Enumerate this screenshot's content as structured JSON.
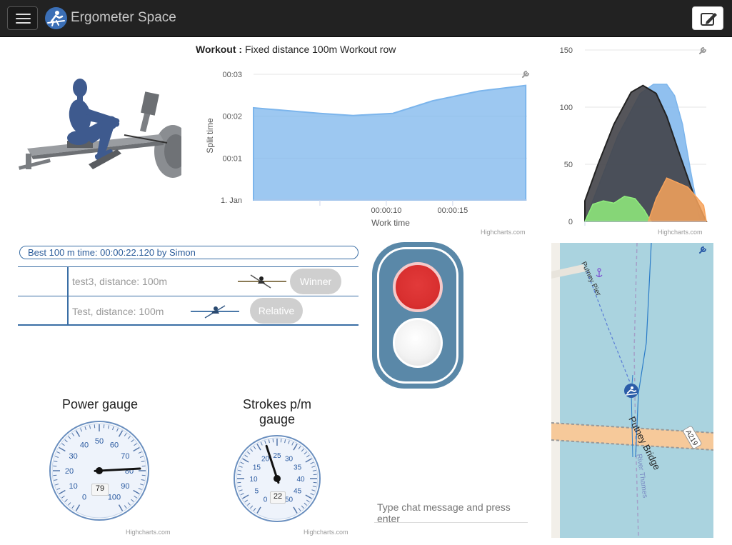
{
  "app": {
    "title": "Ergometer Space"
  },
  "navbar": {
    "menu_icon": "hamburger-icon",
    "logo_icon": "rower-logo-icon",
    "edit_icon": "edit-note-icon"
  },
  "workout": {
    "title_label": "Workout :",
    "title_text": "Fixed distance 100m Workout row"
  },
  "split_chart": {
    "chart_data": {
      "type": "area",
      "xlabel": "Work time",
      "ylabel": "Split time",
      "y_ticks": [
        "1. Jan",
        "00:01",
        "00:02",
        "00:03"
      ],
      "x_ticks": [
        "00:00:10",
        "00:00:15"
      ],
      "ylim_seconds": [
        0,
        180
      ],
      "xlim_seconds": [
        0,
        20.6
      ],
      "x": [
        0,
        5,
        7.5,
        10.5,
        13.5,
        17,
        20.5
      ],
      "y": [
        132,
        124,
        121,
        124,
        142,
        156,
        164
      ],
      "color": "#7cb5ec"
    },
    "credits": "Highcharts.com",
    "menu_icon": "wrench-icon"
  },
  "force_chart": {
    "chart_data": {
      "type": "area",
      "y_ticks": [
        "0",
        "50",
        "100",
        "150"
      ],
      "ylim": [
        0,
        150
      ],
      "series": [
        {
          "color": "#7cb5ec",
          "points": [
            [
              0,
              0
            ],
            [
              10,
              30
            ],
            [
              25,
              75
            ],
            [
              42,
              112
            ],
            [
              52,
              120
            ],
            [
              62,
              120
            ],
            [
              68,
              110
            ],
            [
              74,
              85
            ],
            [
              80,
              45
            ],
            [
              86,
              8
            ],
            [
              88,
              0
            ]
          ]
        },
        {
          "color": "#434348",
          "points": [
            [
              0,
              18
            ],
            [
              10,
              50
            ],
            [
              22,
              85
            ],
            [
              35,
              113
            ],
            [
              44,
              119
            ],
            [
              54,
              112
            ],
            [
              62,
              92
            ],
            [
              72,
              58
            ],
            [
              82,
              25
            ],
            [
              92,
              0
            ]
          ]
        },
        {
          "color": "#90ed7d",
          "points": [
            [
              0,
              0
            ],
            [
              6,
              15
            ],
            [
              14,
              18
            ],
            [
              22,
              16
            ],
            [
              30,
              22
            ],
            [
              38,
              20
            ],
            [
              45,
              10
            ],
            [
              50,
              0
            ]
          ]
        },
        {
          "color": "#f7a35c",
          "points": [
            [
              48,
              0
            ],
            [
              54,
              20
            ],
            [
              62,
              38
            ],
            [
              70,
              34
            ],
            [
              78,
              30
            ],
            [
              84,
              22
            ],
            [
              90,
              14
            ],
            [
              92,
              0
            ]
          ]
        }
      ]
    },
    "credits": "Highcharts.com",
    "menu_icon": "wrench-icon"
  },
  "best": {
    "text": "Best 100 m time: 00:00:22.120 by Simon"
  },
  "rankings": [
    {
      "name": "test3, distance: 100m",
      "badge": "Winner",
      "icon": "rower-boat-icon"
    },
    {
      "name": "Test, distance: 100m",
      "badge": "Relative",
      "icon": "rower-boat-icon"
    }
  ],
  "traffic_light": {
    "state": "red",
    "red": "#d93030",
    "off": "#f2f2f2",
    "body": "#5a88a8"
  },
  "power_gauge": {
    "title": "Power gauge",
    "value": 79,
    "value_text": "79",
    "min": 0,
    "max": 100,
    "ticks": [
      "0",
      "10",
      "20",
      "30",
      "40",
      "50",
      "60",
      "70",
      "80",
      "90",
      "100"
    ],
    "credits": "Highcharts.com"
  },
  "strokes_gauge": {
    "title": "Strokes p/m gauge",
    "value": 22,
    "value_text": "22",
    "min": 0,
    "max": 50,
    "ticks": [
      "0",
      "5",
      "10",
      "15",
      "20",
      "25",
      "30",
      "35",
      "40",
      "45",
      "50"
    ],
    "credits": "Highcharts.com"
  },
  "chat": {
    "placeholder": "Type chat message and press enter"
  },
  "map": {
    "labels": [
      "Putney Pier",
      "Putney Bridge",
      "River Thames",
      "A219"
    ],
    "marker_icon": "rower-location-icon",
    "anchor_icon": "anchor-icon",
    "menu_icon": "wrench-icon"
  }
}
